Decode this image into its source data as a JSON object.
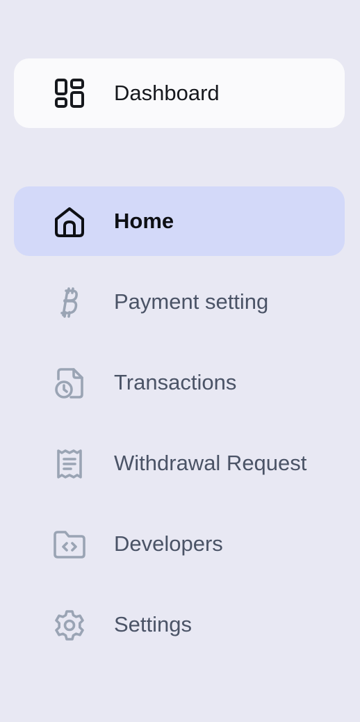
{
  "colors": {
    "background": "#e8e8f3",
    "dashboard_bg": "#fafafc",
    "active_bg": "#d3d9f9",
    "active_icon": "#0d0f14",
    "muted_icon": "#9aa4b4",
    "muted_text": "#4a5366"
  },
  "dashboard": {
    "label": "Dashboard",
    "icon": "dashboard-grid-icon"
  },
  "nav": {
    "items": [
      {
        "label": "Home",
        "icon": "home-icon",
        "active": true
      },
      {
        "label": "Payment setting",
        "icon": "bitcoin-icon",
        "active": false
      },
      {
        "label": "Transactions",
        "icon": "file-clock-icon",
        "active": false
      },
      {
        "label": "Withdrawal Request",
        "icon": "receipt-icon",
        "active": false
      },
      {
        "label": "Developers",
        "icon": "folder-code-icon",
        "active": false
      },
      {
        "label": "Settings",
        "icon": "gear-icon",
        "active": false
      }
    ]
  }
}
